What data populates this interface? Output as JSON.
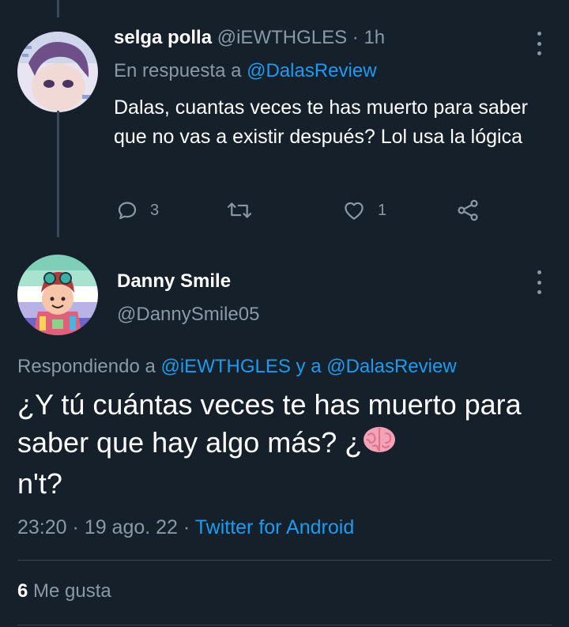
{
  "parent_tweet": {
    "name": "selga polla",
    "handle": "@iEWTHGLES",
    "separator": "·",
    "time": "1h",
    "reply_prefix": "En respuesta a",
    "reply_handle": "@DalasReview",
    "text": "Dalas, cuantas veces te has muerto para saber que no vas a existir después? Lol usa la lógica",
    "reply_count": "3",
    "like_count": "1"
  },
  "main_tweet": {
    "name": "Danny Smile",
    "handle": "@DannySmile05",
    "responding_prefix": "Respondiendo a",
    "responding_handle_1": "@iEWTHGLES",
    "responding_join": "y a",
    "responding_handle_2": "@DalasReview",
    "text_part1": "¿Y tú cuántas veces te has muerto para saber que hay algo más? ¿",
    "text_part2": "n't?",
    "time": "23:20",
    "separator": "·",
    "date": "19 ago. 22",
    "client": "Twitter for Android",
    "likes_count": "6",
    "likes_label": "Me gusta"
  },
  "colors": {
    "background": "#15202b",
    "link": "#1d9bf0",
    "muted": "#8b98a5",
    "divider": "#38444d"
  },
  "icons": [
    "more-vertical-icon",
    "reply-icon",
    "retweet-icon",
    "like-icon",
    "share-icon",
    "brain-emoji"
  ]
}
